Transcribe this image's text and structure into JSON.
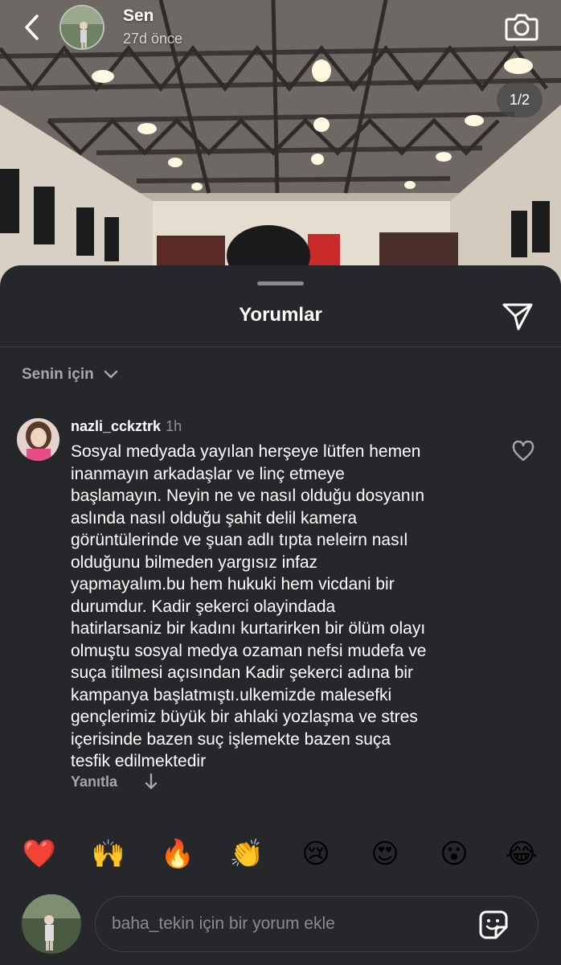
{
  "story": {
    "username": "Sen",
    "time": "27d önce",
    "page_indicator": "1/2"
  },
  "comments_sheet": {
    "title": "Yorumlar",
    "sort_label": "Senin için"
  },
  "comment": {
    "username": "nazli_cckztrk",
    "time": "1h",
    "lines": [
      "Sosyal medyada yayılan herşeye lütfen hemen",
      "inanmayın arkadaşlar ve linç etmeye",
      "başlamayın. Neyin ne ve nasıl olduğu dosyanın",
      "aslında nasıl olduğu şahit delil kamera",
      "görüntülerinde ve şuan adlı tıpta neleirn nasıl",
      "olduğunu bilmeden yargısız infaz",
      "yapmayalım.bu hem hukuki hem vicdani bir",
      "durumdur. Kadir şekerci olayindada",
      "hatirlarsaniz bir kadını kurtarirken bir ölüm olayı",
      "olmuştu sosyal medya ozaman nefsi mudefa ve",
      "suça itilmesi açısından Kadir şekerci adına bir",
      "kampanya başlatmıştı.ulkemizde malesefki",
      "gençlerimiz büyük bir ahlaki yozlaşma ve stres",
      "içerisinde bazen suç işlemekte bazen suça",
      "tesfik edilmektedir"
    ],
    "reply_label": "Yanıtla"
  },
  "reactions": [
    "❤️",
    "🙌",
    "🔥",
    "👏",
    "😢",
    "😍",
    "😮",
    "😂"
  ],
  "comment_input": {
    "placeholder": "baha_tekin için bir yorum ekle"
  },
  "colors": {
    "sheet_bg": "#25272b",
    "text_primary": "#ffffff",
    "text_secondary": "#a5a7ab"
  },
  "icons": {
    "back": "chevron-left-icon",
    "camera": "camera-icon",
    "share": "paper-plane-icon",
    "sort": "chevron-down-icon",
    "like": "heart-outline-icon",
    "reply_arrow": "arrow-down-icon",
    "sticker": "sticker-icon"
  }
}
